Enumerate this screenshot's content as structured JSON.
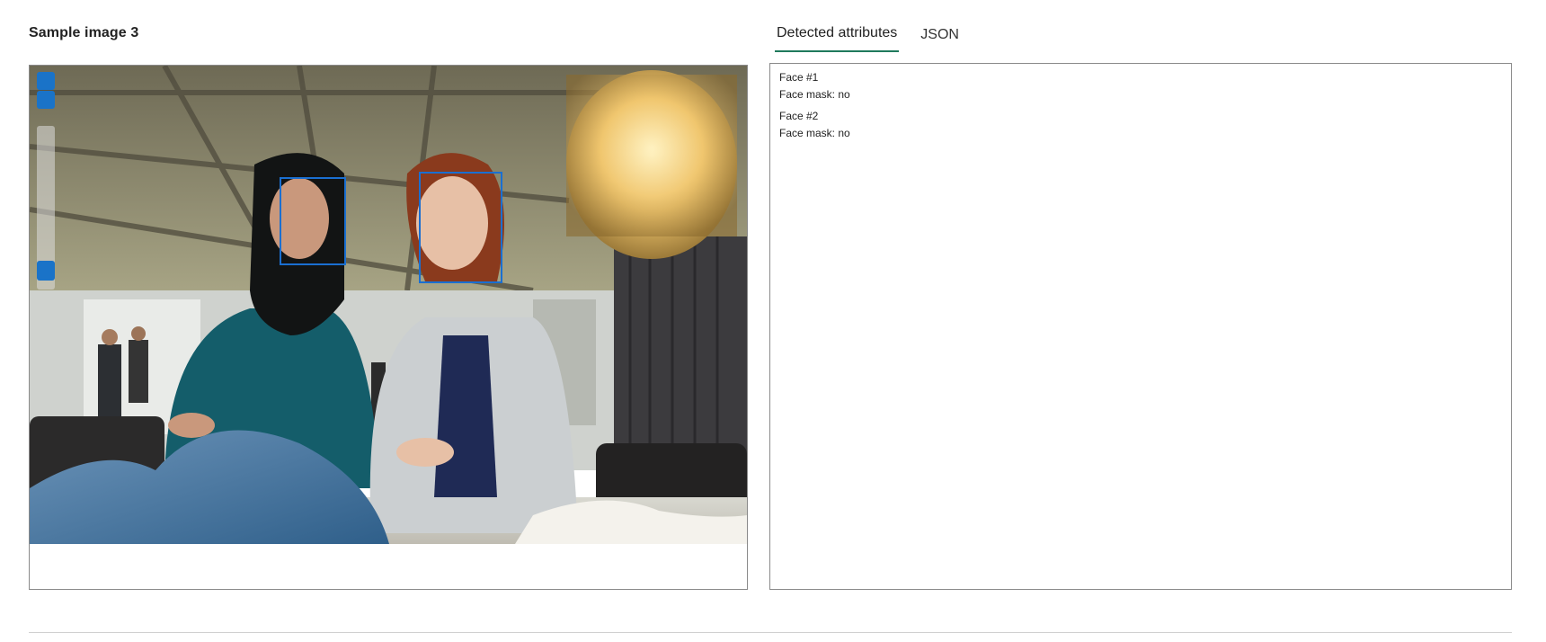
{
  "sample": {
    "title": "Sample image 3"
  },
  "tabs": [
    {
      "label": "Detected attributes",
      "active": true
    },
    {
      "label": "JSON",
      "active": false
    }
  ],
  "faces": [
    {
      "label": "Face #1",
      "mask": "Face mask: no"
    },
    {
      "label": "Face #2",
      "mask": "Face mask: no"
    }
  ],
  "colors": {
    "accent": "#1a6fd1",
    "tab_underline": "#1f7a5c"
  }
}
